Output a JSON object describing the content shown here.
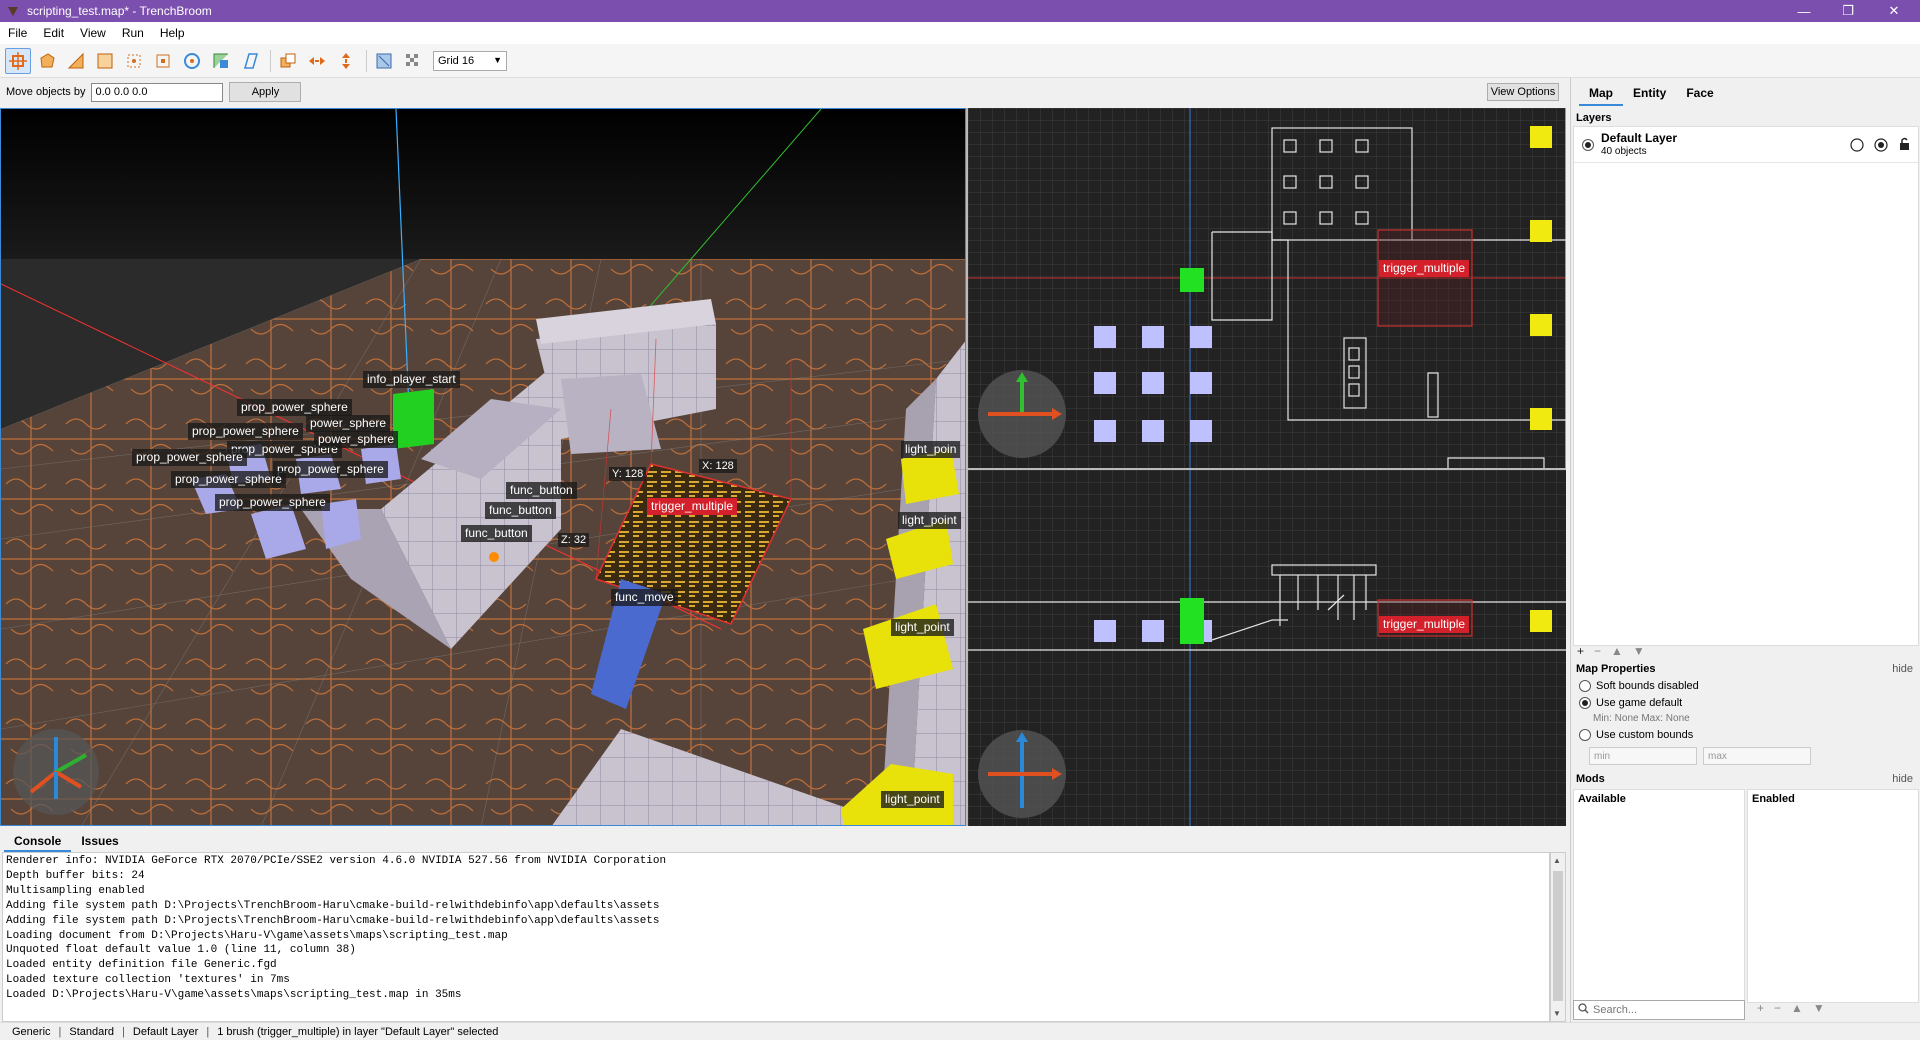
{
  "window": {
    "title": "scripting_test.map* - TrenchBroom",
    "controls": {
      "minimize": "—",
      "restore": "❐",
      "close": "✕"
    }
  },
  "menu": [
    "File",
    "Edit",
    "View",
    "Run",
    "Help"
  ],
  "toolbar": {
    "tools": [
      "move-objects-icon",
      "vertex-tool-icon",
      "edge-tool-icon",
      "face-tool-icon",
      "rotate-tool-icon",
      "scale-tool-icon",
      "shear-tool-icon",
      "clip-tool-icon",
      "brush-tool-icon",
      "duplicate-icon",
      "flip-horizontal-icon",
      "flip-vertical-icon",
      "texture-lock-icon",
      "uv-lock-icon"
    ],
    "grid_label": "Grid 16"
  },
  "movebar": {
    "label": "Move objects by",
    "value": "0.0 0.0 0.0",
    "apply_label": "Apply",
    "view_options_label": "View Options"
  },
  "viewport3d": {
    "labels": {
      "info_player_start": "info_player_start",
      "power_sphere_1": "prop_power_sphere",
      "power_sphere_2": "power_sphere",
      "power_sphere_3": "prop_power_sphere",
      "power_sphere_4": "prop_power_sphere",
      "power_sphere_5": "power_sphere",
      "power_sphere_6": "prop_power_sphere",
      "power_sphere_7": "prop_power_sphere",
      "power_sphere_8": "prop_power_sphere",
      "power_sphere_9": "prop_power_sphere",
      "func_button_1": "func_button",
      "func_button_2": "func_button",
      "func_button_3": "func_button",
      "trigger_multiple": "trigger_multiple",
      "func_move": "func_move",
      "light_point_1": "light_poin",
      "light_point_2": "light_point",
      "light_point_3": "light_point",
      "light_point_4": "light_point"
    },
    "dims": {
      "x": "X: 128",
      "y": "Y: 128",
      "z": "Z: 32"
    }
  },
  "viewport_top": {
    "trigger_label": "trigger_multiple"
  },
  "viewport_front": {
    "trigger_label": "trigger_multiple"
  },
  "right_panel": {
    "tabs": [
      "Map",
      "Entity",
      "Face"
    ],
    "layers_title": "Layers",
    "layer_name": "Default Layer",
    "layer_count": "40 objects",
    "layer_buttons": {
      "add": "+",
      "remove": "−",
      "up": "▲",
      "down": "▼"
    },
    "map_properties_title": "Map Properties",
    "hide_label": "hide",
    "soft_bounds_disabled": "Soft bounds disabled",
    "use_game_default": "Use game default",
    "bounds_info": "Min:  None  Max:  None",
    "use_custom_bounds": "Use custom bounds",
    "min_placeholder": "min",
    "max_placeholder": "max",
    "mods_title": "Mods",
    "mods_available": "Available",
    "mods_enabled": "Enabled",
    "search_placeholder": "Search...",
    "mods_buttons": {
      "add": "+",
      "remove": "−",
      "up": "▲",
      "down": "▼"
    }
  },
  "console": {
    "tabs": [
      "Console",
      "Issues"
    ],
    "lines": [
      "Renderer info: NVIDIA GeForce RTX 2070/PCIe/SSE2 version 4.6.0 NVIDIA 527.56 from NVIDIA Corporation",
      "Depth buffer bits: 24",
      "Multisampling enabled",
      "Adding file system path D:\\Projects\\TrenchBroom-Haru\\cmake-build-relwithdebinfo\\app\\defaults\\assets",
      "Adding file system path D:\\Projects\\TrenchBroom-Haru\\cmake-build-relwithdebinfo\\app\\defaults\\assets",
      "Loading document from D:\\Projects\\Haru-V\\game\\assets\\maps\\scripting_test.map",
      "Unquoted float default value 1.0 (line 11, column 38)",
      "Loaded entity definition file Generic.fgd",
      "Loaded texture collection 'textures' in 7ms",
      "Loaded D:\\Projects\\Haru-V\\game\\assets\\maps\\scripting_test.map in 35ms"
    ]
  },
  "status": {
    "game": "Generic",
    "mode": "Standard",
    "layer": "Default Layer",
    "selection": "1 brush (trigger_multiple) in layer \"Default Layer\" selected"
  }
}
